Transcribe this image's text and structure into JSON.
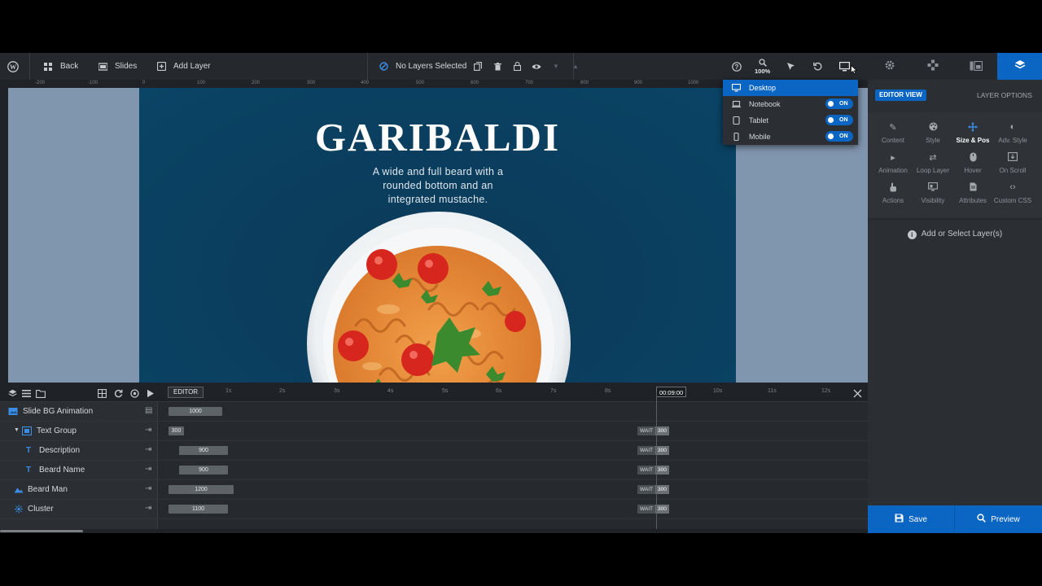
{
  "toolbar": {
    "back_label": "Back",
    "slides_label": "Slides",
    "add_layer_label": "Add Layer",
    "selection_label": "No Layers Selected",
    "zoom_label": "100%"
  },
  "ruler": {
    "ticks": [
      "-200",
      "-100",
      "0",
      "100",
      "200",
      "300",
      "400",
      "500",
      "600",
      "700",
      "800",
      "900",
      "1000"
    ]
  },
  "slide": {
    "title": "GARIBALDI",
    "description": "A wide and full beard with a rounded bottom and an integrated mustache."
  },
  "device_menu": {
    "items": [
      {
        "label": "Desktop",
        "toggle": ""
      },
      {
        "label": "Notebook",
        "toggle": "ON"
      },
      {
        "label": "Tablet",
        "toggle": "ON"
      },
      {
        "label": "Mobile",
        "toggle": "ON"
      }
    ]
  },
  "panel": {
    "editor_view_label": "EDITOR VIEW",
    "layer_options_label": "LAYER OPTIONS",
    "options": [
      {
        "label": "Content",
        "icon": "pencil-icon"
      },
      {
        "label": "Style",
        "icon": "palette-icon"
      },
      {
        "label": "Size & Pos",
        "icon": "move-icon"
      },
      {
        "label": "Adv. Style",
        "icon": "contrast-icon"
      },
      {
        "label": "Animation",
        "icon": "play-icon"
      },
      {
        "label": "Loop Layer",
        "icon": "loop-icon"
      },
      {
        "label": "Hover",
        "icon": "mouse-icon"
      },
      {
        "label": "On Scroll",
        "icon": "scroll-icon"
      },
      {
        "label": "Actions",
        "icon": "hand-icon"
      },
      {
        "label": "Visibility",
        "icon": "visibility-icon"
      },
      {
        "label": "Attributes",
        "icon": "document-icon"
      },
      {
        "label": "Custom CSS",
        "icon": "code-icon"
      }
    ],
    "empty_message": "Add or Select Layer(s)",
    "save_label": "Save",
    "preview_label": "Preview"
  },
  "timeline": {
    "editor_label": "EDITOR",
    "ticks": [
      "1s",
      "2s",
      "3s",
      "4s",
      "5s",
      "6s",
      "7s",
      "8s",
      "10s",
      "11s",
      "12s"
    ],
    "playhead_label": "00:09:00",
    "wait_label": "WAIT",
    "layers": [
      {
        "name": "Slide BG Animation",
        "duration": "1000",
        "wait": ""
      },
      {
        "name": "Text Group",
        "duration": "300",
        "wait": "300"
      },
      {
        "name": "Description",
        "duration": "900",
        "wait": "300"
      },
      {
        "name": "Beard Name",
        "duration": "900",
        "wait": "300"
      },
      {
        "name": "Beard Man",
        "duration": "1200",
        "wait": "300"
      },
      {
        "name": "Cluster",
        "duration": "1100",
        "wait": "300"
      }
    ]
  },
  "colors": {
    "accent": "#0a66c2",
    "slide_bg": "#0b3e5e",
    "canvas_bg": "#8095ae"
  }
}
